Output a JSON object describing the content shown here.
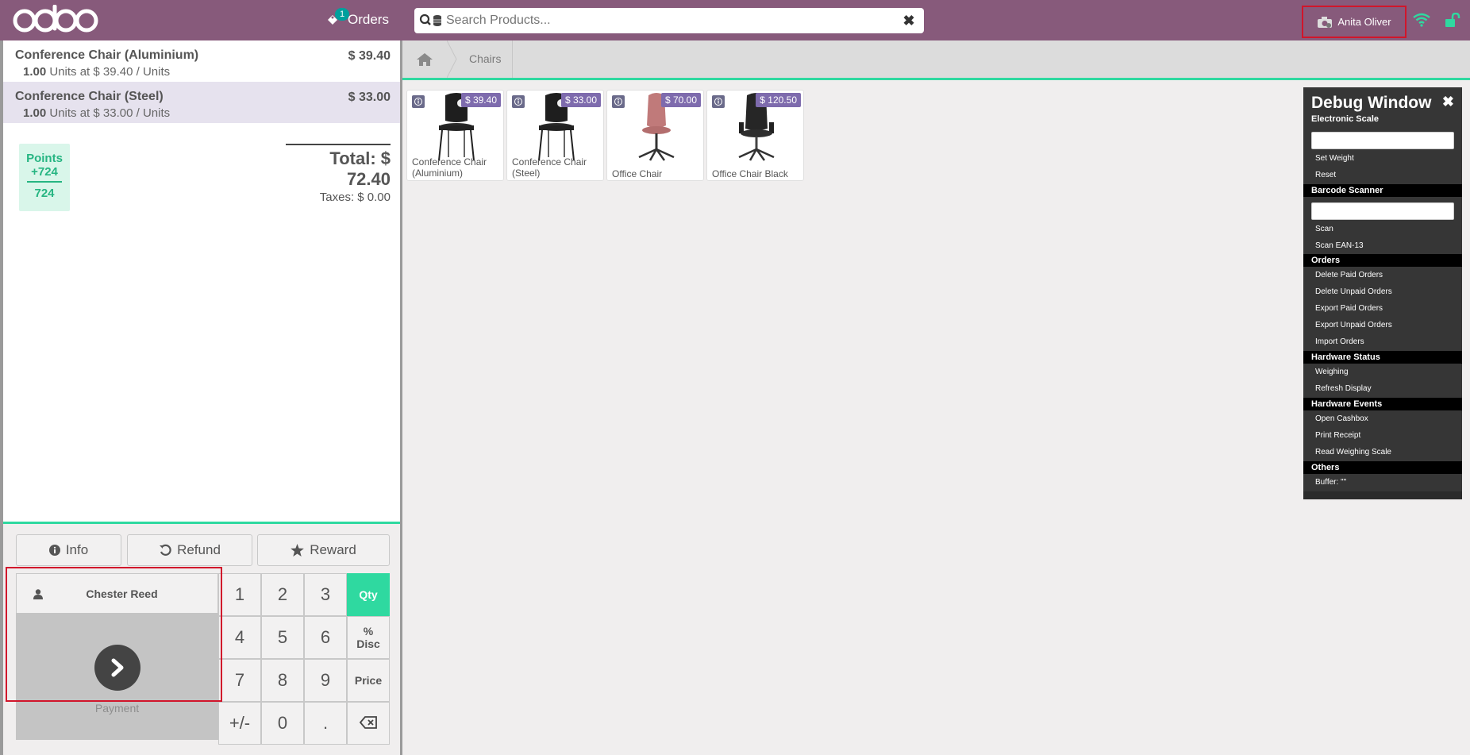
{
  "header": {
    "logo": "odoo",
    "orders_label": "Orders",
    "orders_count": "1",
    "search_placeholder": "Search Products...",
    "cashier_name": "Anita Oliver",
    "bg_color": "#875a7b"
  },
  "order": {
    "lines": [
      {
        "name": "Conference Chair (Aluminium)",
        "price": "$ 39.40",
        "qty": "1.00",
        "info": "Units at $ 39.40 / Units",
        "selected": false
      },
      {
        "name": "Conference Chair (Steel)",
        "price": "$ 33.00",
        "qty": "1.00",
        "info": "Units at $ 33.00 / Units",
        "selected": true
      }
    ],
    "loyalty": {
      "label": "Points",
      "won": "+724",
      "total": "724"
    },
    "total": "Total: $ 72.40",
    "taxes": "Taxes: $ 0.00"
  },
  "controls": {
    "info": "Info",
    "refund": "Refund",
    "reward": "Reward",
    "customer": "Chester Reed",
    "payment": "Payment",
    "keys": [
      "1",
      "2",
      "3",
      "4",
      "5",
      "6",
      "7",
      "8",
      "9",
      "+/-",
      "0",
      "."
    ],
    "modes": {
      "qty": "Qty",
      "disc_line1": "%",
      "disc_line2": "Disc",
      "price": "Price"
    }
  },
  "breadcrumb": {
    "category": "Chairs"
  },
  "products": [
    {
      "name": "Conference Chair (Aluminium)",
      "price": "$ 39.40",
      "kind": "black-chair"
    },
    {
      "name": "Conference Chair (Steel)",
      "price": "$ 33.00",
      "kind": "black-chair"
    },
    {
      "name": "Office Chair",
      "price": "$ 70.00",
      "kind": "pink-chair"
    },
    {
      "name": "Office Chair Black",
      "price": "$ 120.50",
      "kind": "office-chair"
    }
  ],
  "debug": {
    "title": "Debug Window",
    "sections": {
      "scale": "Electronic Scale",
      "barcode": "Barcode Scanner",
      "orders": "Orders",
      "hw_status": "Hardware Status",
      "hw_events": "Hardware Events",
      "others": "Others"
    },
    "items": {
      "set_weight": "Set Weight",
      "reset": "Reset",
      "scan": "Scan",
      "scan_ean": "Scan EAN-13",
      "delete_paid": "Delete Paid Orders",
      "delete_unpaid": "Delete Unpaid Orders",
      "export_paid": "Export Paid Orders",
      "export_unpaid": "Export Unpaid Orders",
      "import": "Import Orders",
      "weighing": "Weighing",
      "refresh": "Refresh Display",
      "open_cashbox": "Open Cashbox",
      "print_receipt": "Print Receipt",
      "read_scale": "Read Weighing Scale",
      "buffer": "Buffer: \"\""
    }
  }
}
